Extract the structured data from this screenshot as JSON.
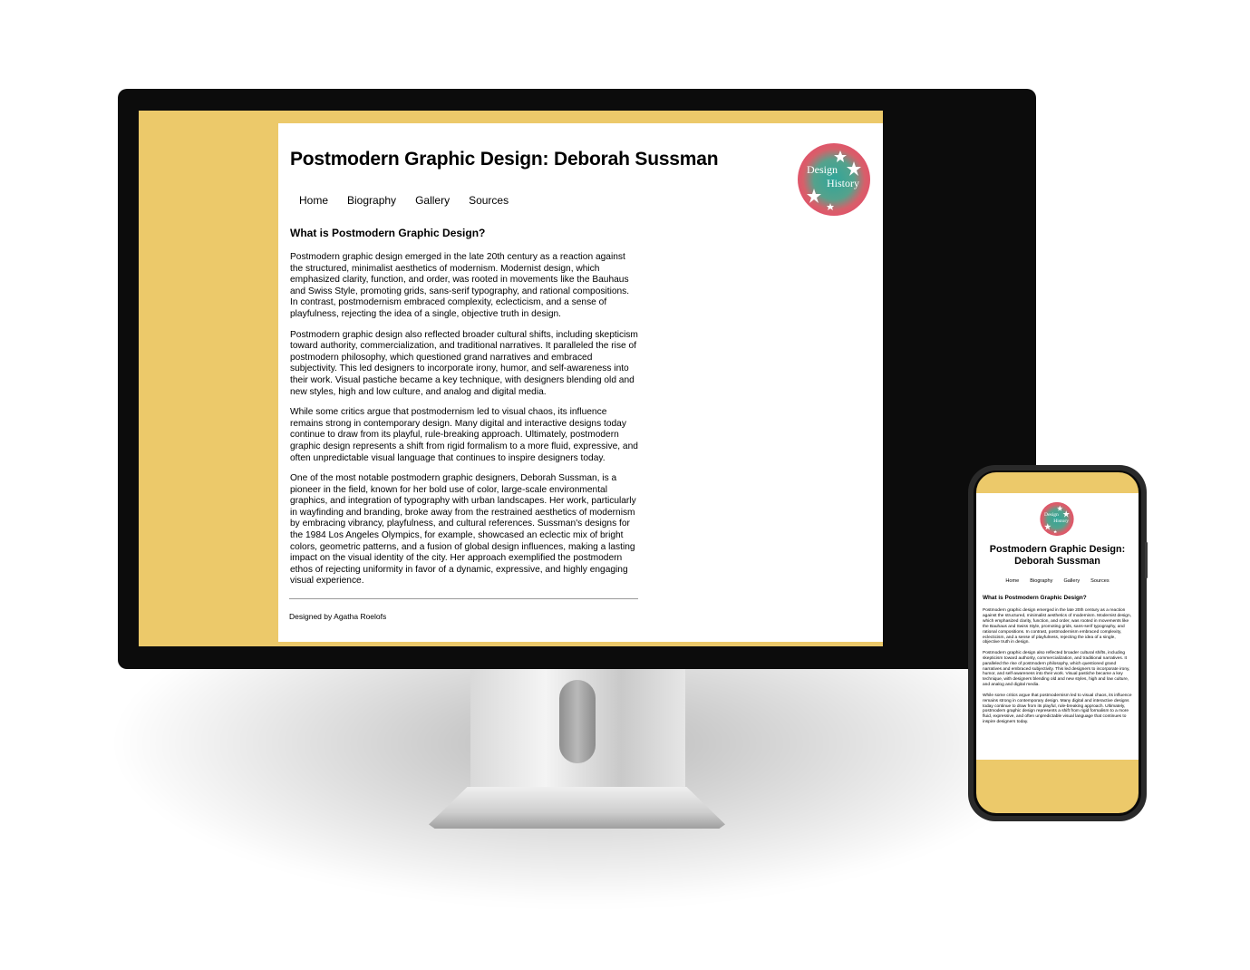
{
  "site": {
    "title": "Postmodern Graphic Design: Deborah Sussman",
    "logo": {
      "line1": "Design",
      "line2": "History"
    },
    "nav": [
      "Home",
      "Biography",
      "Gallery",
      "Sources"
    ],
    "section_heading": "What is Postmodern Graphic Design?",
    "paragraphs": [
      "Postmodern graphic design emerged in the late 20th century as a reaction against the structured, minimalist aesthetics of modernism. Modernist design, which emphasized clarity, function, and order, was rooted in movements like the Bauhaus and Swiss Style, promoting grids, sans-serif typography, and rational compositions. In contrast, postmodernism embraced complexity, eclecticism, and a sense of playfulness, rejecting the idea of a single, objective truth in design.",
      "Postmodern graphic design also reflected broader cultural shifts, including skepticism toward authority, commercialization, and traditional narratives. It paralleled the rise of postmodern philosophy, which questioned grand narratives and embraced subjectivity. This led designers to incorporate irony, humor, and self-awareness into their work. Visual pastiche became a key technique, with designers blending old and new styles, high and low culture, and analog and digital media.",
      "While some critics argue that postmodernism led to visual chaos, its influence remains strong in contemporary design. Many digital and interactive designs today continue to draw from its playful, rule-breaking approach. Ultimately, postmodern graphic design represents a shift from rigid formalism to a more fluid, expressive, and often unpredictable visual language that continues to inspire designers today.",
      "One of the most notable postmodern graphic designers, Deborah Sussman, is a pioneer in the field, known for her bold use of color, large-scale environmental graphics, and integration of typography with urban landscapes. Her work, particularly in wayfinding and branding, broke away from the restrained aesthetics of modernism by embracing vibrancy, playfulness, and cultural references. Sussman's designs for the 1984 Los Angeles Olympics, for example, showcased an eclectic mix of bright colors, geometric patterns, and a fusion of global design influences, making a lasting impact on the visual identity of the city. Her approach exemplified the postmodern ethos of rejecting uniformity in favor of a dynamic, expressive, and highly engaging visual experience."
    ],
    "footer": "Designed by Agatha Roelofs"
  },
  "colors": {
    "background_mustard": "#ecc96a",
    "logo_outer": "#e0556a",
    "logo_inner": "#2fa69a"
  },
  "icons": [
    "star-icon"
  ]
}
